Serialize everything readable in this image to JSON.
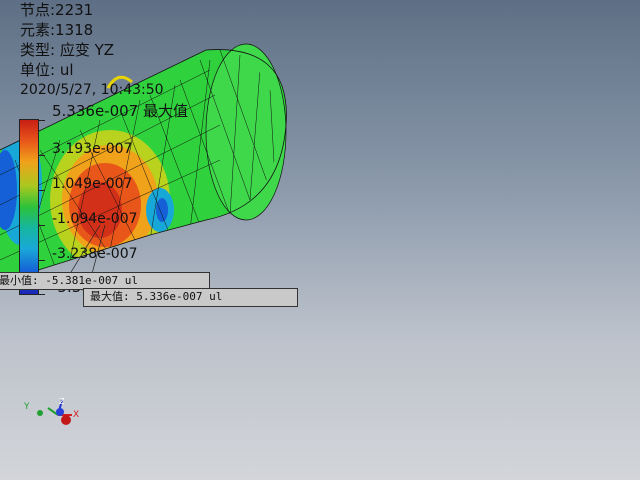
{
  "info": {
    "nodes": "节点:2231",
    "elements": "元素:1318",
    "type": "类型: 应变 YZ",
    "unit": "单位: ul",
    "datetime": "2020/5/27, 10:43:50"
  },
  "legend": {
    "max_label": "5.336e-007 最大值",
    "labels": [
      "3.193e-007",
      "1.049e-007",
      "-1.094e-007",
      "-3.238e-007"
    ],
    "min_label": "-5.381e-007 最小值",
    "colors": [
      "#c81e14",
      "#f0a21a",
      "#2dc23a",
      "#1aa8d8",
      "#1a24b8"
    ]
  },
  "callouts": {
    "min_box": "最小值: -5.381e-007 ul",
    "max_box": "最大值: 5.336e-007 ul"
  },
  "axes": {
    "x": "X",
    "y": "Y",
    "z": "Z"
  }
}
